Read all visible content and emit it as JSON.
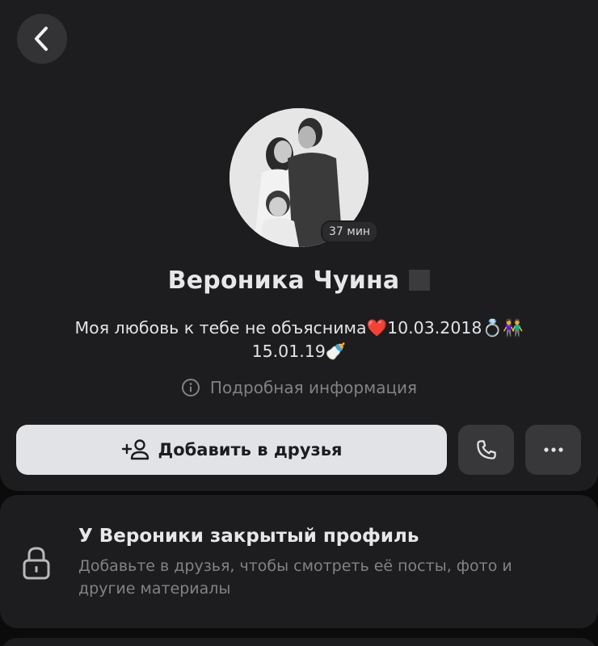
{
  "profile": {
    "name": "Вероника Чуина",
    "last_seen": "37 мин",
    "status_line1": "Моя любовь к тебе не объяснима❤️10.03.2018💍👫",
    "status_line2": "15.01.19🍼",
    "more_info_label": "Подробная информация"
  },
  "actions": {
    "add_friend_label": "Добавить в друзья"
  },
  "private_notice": {
    "title": "У Вероники закрытый профиль",
    "description": "Добавьте в друзья, чтобы смотреть её посты, фото и другие материалы"
  },
  "icons": {
    "back": "chevron-left-icon",
    "info": "info-circle-icon",
    "add_friend": "user-add-icon",
    "call": "phone-icon",
    "more": "more-horizontal-icon",
    "lock": "lock-icon"
  },
  "colors": {
    "background": "#0b0b0b",
    "card": "#1d1d1f",
    "primary_button": "#e1e3e6",
    "secondary_button": "#38383a",
    "muted_text": "#828282"
  }
}
